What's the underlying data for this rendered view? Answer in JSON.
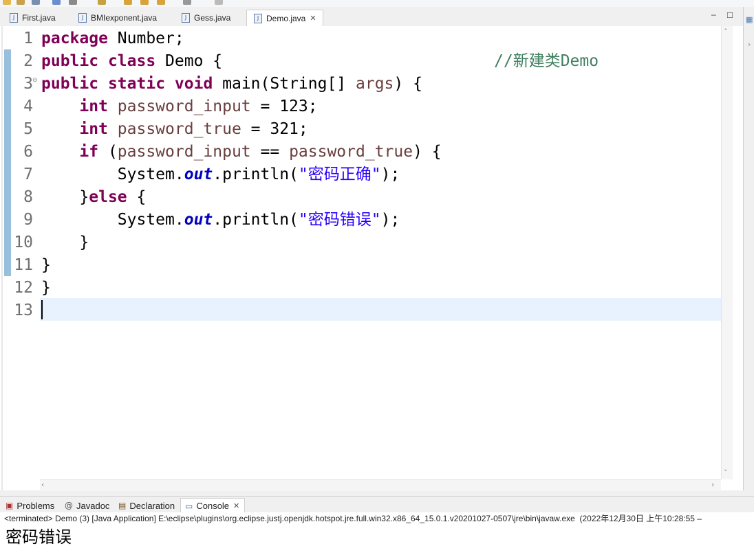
{
  "editor_tabs": [
    {
      "label": "First.java",
      "active": false
    },
    {
      "label": "BMIexponent.java",
      "active": false
    },
    {
      "label": "Gess.java",
      "active": false
    },
    {
      "label": "Demo.java",
      "active": true
    }
  ],
  "line_numbers": [
    "1",
    "2",
    "3",
    "4",
    "5",
    "6",
    "7",
    "8",
    "9",
    "10",
    "11",
    "12",
    "13"
  ],
  "code": {
    "l1_kw": "package",
    "l1_rest": " Number;",
    "l2_kw1": "public",
    "l2_kw2": "class",
    "l2_rest": " Demo {",
    "l2_comment": "//新建类Demo",
    "l3_kw1": "public",
    "l3_kw2": "static",
    "l3_kw3": "void",
    "l3_a": " main(String[] ",
    "l3_var": "args",
    "l3_b": ") {",
    "l4_kw": "int",
    "l4_var": "password_input",
    "l4_rest": " = 123;",
    "l5_kw": "int",
    "l5_var": "password_true",
    "l5_rest": " = 321;",
    "l6_kw": "if",
    "l6_a": " (",
    "l6_var1": "password_input",
    "l6_b": " == ",
    "l6_var2": "password_true",
    "l6_c": ") {",
    "l7_a": "System.",
    "l7_field": "out",
    "l7_b": ".println(",
    "l7_str": "\"密码正确\"",
    "l7_c": ");",
    "l8_a": "}",
    "l8_kw": "else",
    "l8_b": " {",
    "l9_a": "System.",
    "l9_field": "out",
    "l9_b": ".println(",
    "l9_str": "\"密码错误\"",
    "l9_c": ");",
    "l10": "}",
    "l11": "}",
    "l12": "}"
  },
  "console_tabs": [
    {
      "label": "Problems",
      "icon": "problems-icon"
    },
    {
      "label": "Javadoc",
      "icon": "javadoc-icon"
    },
    {
      "label": "Declaration",
      "icon": "declaration-icon"
    },
    {
      "label": "Console",
      "icon": "console-icon",
      "active": true
    }
  ],
  "console": {
    "status": "<terminated> Demo (3) [Java Application] E:\\eclipse\\plugins\\org.eclipse.justj.openjdk.hotspot.jre.full.win32.x86_64_15.0.1.v20201027-0507\\jre\\bin\\javaw.exe  (2022年12月30日 上午10:28:55 –",
    "output": "密码错误"
  },
  "colors": {
    "keyword": "#7f0055",
    "string": "#2a00ff",
    "comment": "#3f7f5f",
    "local_var": "#6a3e3e",
    "static_field": "#0000c0",
    "current_line": "#e8f2fe"
  }
}
